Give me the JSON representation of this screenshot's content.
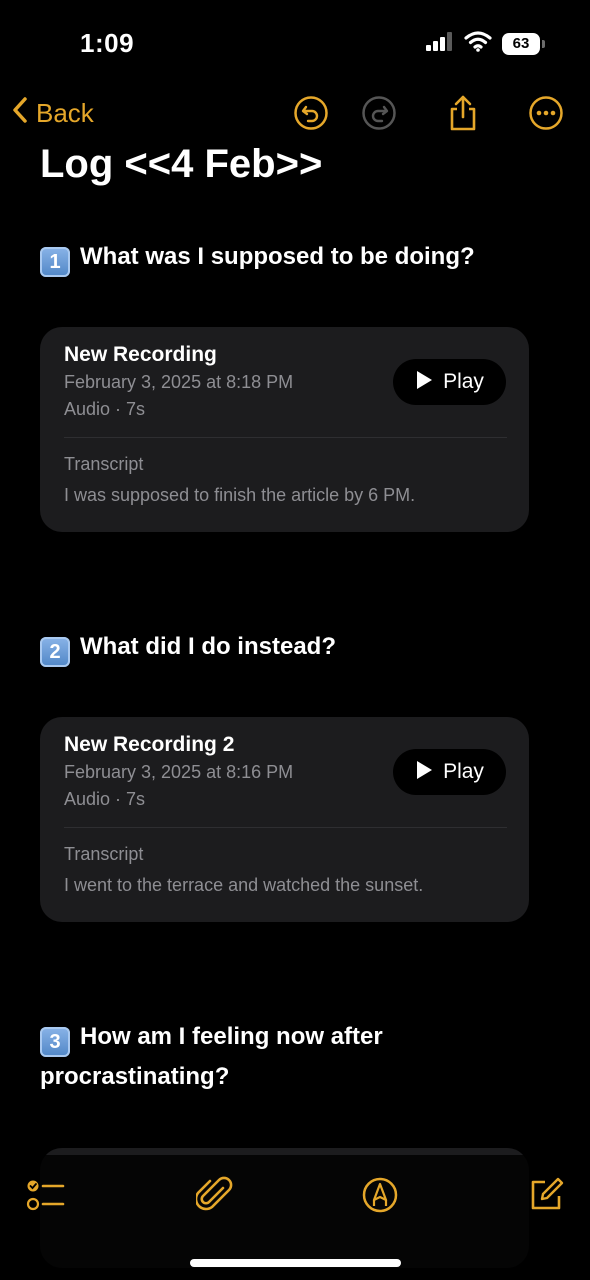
{
  "status_bar": {
    "time": "1:09",
    "battery": "63"
  },
  "nav": {
    "back_label": "Back",
    "icons": [
      "undo-icon",
      "redo-icon",
      "share-icon",
      "more-icon"
    ],
    "accent_color": "#e5a72a"
  },
  "note": {
    "title": "Log <<4 Feb>>",
    "sections": [
      {
        "number": "1",
        "question": "What was I supposed to be doing?",
        "recording": {
          "title": "New Recording",
          "date": "February 3, 2025 at 8:18 PM",
          "meta": "Audio · 7s",
          "play_label": "Play",
          "transcript_label": "Transcript",
          "transcript": "I was supposed to finish the article by 6 PM."
        }
      },
      {
        "number": "2",
        "question": "What did I do instead?",
        "recording": {
          "title": "New Recording 2",
          "date": "February 3, 2025 at 8:16 PM",
          "meta": "Audio · 7s",
          "play_label": "Play",
          "transcript_label": "Transcript",
          "transcript": "I went to the terrace and watched the sunset."
        }
      },
      {
        "number": "3",
        "question": "How am I feeling now after procrastinating?"
      }
    ]
  },
  "toolbar": {
    "icons": [
      "checklist-icon",
      "attachment-icon",
      "markup-pen-icon",
      "compose-icon"
    ]
  }
}
